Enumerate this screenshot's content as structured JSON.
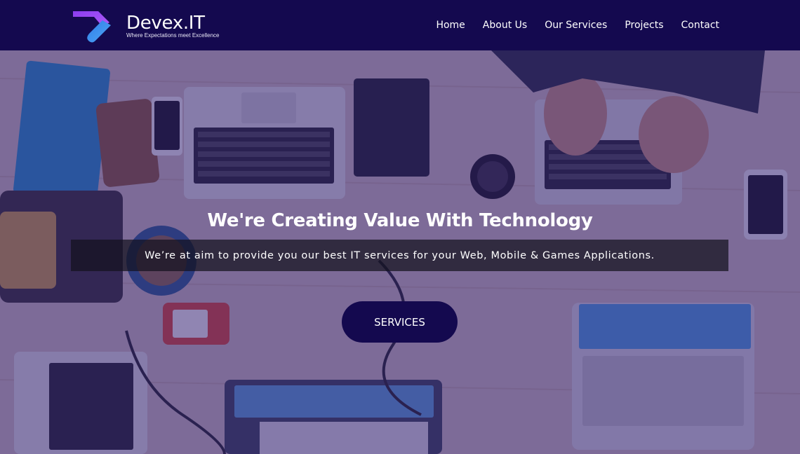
{
  "brand": {
    "name": "Devex.IT",
    "tagline": "Where Expectations meet Excellence"
  },
  "nav": {
    "items": [
      {
        "label": "Home"
      },
      {
        "label": "About Us"
      },
      {
        "label": "Our Services"
      },
      {
        "label": "Projects"
      },
      {
        "label": "Contact"
      }
    ]
  },
  "hero": {
    "title": "We're Creating Value With Technology",
    "subtitle": "We’re at aim to provide you our best IT services for your Web, Mobile & Games Applications.",
    "cta_label": "SERVICES",
    "background": "desk-with-laptops-photo"
  },
  "colors": {
    "header_bg": "#14094f",
    "overlay": "#2c1a76",
    "button_bg": "#14094f",
    "logo_gradient_start": "#8a3cf0",
    "logo_gradient_end": "#3b8cf0"
  }
}
